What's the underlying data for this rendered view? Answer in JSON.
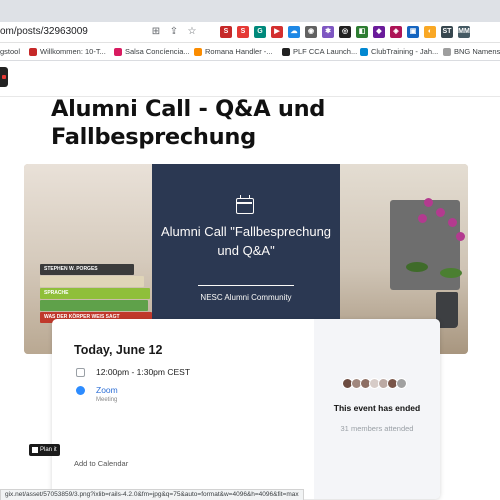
{
  "browser": {
    "url": "om/posts/32963009",
    "status_url": "gix.net/asset/57053859/3.png?ixlib=rails-4.2.0&fm=jpg&q=75&auto=format&w=4096&h=4096&fit=max",
    "bookmarks": [
      {
        "label": "gstool",
        "color": "#5f6368"
      },
      {
        "label": "Willkommen: 10-T...",
        "color": "#c62828"
      },
      {
        "label": "Salsa Concíencia...",
        "color": "#d81b60"
      },
      {
        "label": "Romana Handler -...",
        "color": "#fb8c00"
      },
      {
        "label": "PLF CCA Launch...",
        "color": "#212121"
      },
      {
        "label": "ClubTraining - Jah...",
        "color": "#0288d1"
      },
      {
        "label": "BNG Namens",
        "color": "#5f6368"
      }
    ],
    "extension_labels": [
      "ST",
      "MM"
    ]
  },
  "event": {
    "title": "Alumni Call - Q&A und Fallbesprechung",
    "banner_title": "Alumni Call \"Fallbesprechung und Q&A\"",
    "banner_org": "NESC Alumni Community",
    "book_spines": [
      "STEPHEN W. PORGES",
      "SPRACHE",
      "WAS DER KÖRPER WEIS SAGT"
    ],
    "date": "Today, June 12",
    "time": "12:00pm - 1:30pm CEST",
    "location": "Zoom",
    "location_type": "Meeting",
    "add_to_calendar": "Add to Calendar",
    "ended_label": "This event has ended",
    "attended_label": "31 members attended"
  },
  "badge": {
    "label": "Plan it"
  },
  "colors": {
    "overlay": "#1f2f4c",
    "link": "#2d6fd6",
    "sidebar": "#f4f5f8"
  }
}
